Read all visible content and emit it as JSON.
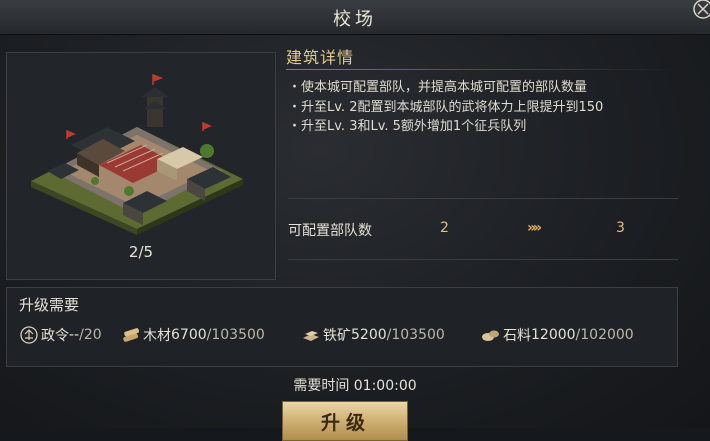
{
  "window": {
    "title": "校场"
  },
  "preview": {
    "level": "2/5"
  },
  "details": {
    "title": "建筑详情",
    "lines": [
      "・使本城可配置部队，并提高本城可配置的部队数量",
      "・升至Lv. 2配置到本城部队的武将体力上限提升到150",
      "・升至Lv. 3和Lv. 5额外增加1个征兵队列"
    ],
    "stat": {
      "label": "可配置部队数",
      "current": "2",
      "arrow": "»»",
      "next": "3"
    }
  },
  "requirements": {
    "title": "升级需要",
    "items": [
      {
        "name": "政令",
        "have": "--",
        "need": "/20",
        "icon": "decree-icon"
      },
      {
        "name": "木材",
        "have": "6700",
        "need": "/103500",
        "icon": "wood-icon"
      },
      {
        "name": "铁矿",
        "have": "5200",
        "need": "/103500",
        "icon": "iron-icon"
      },
      {
        "name": "石料",
        "have": "12000",
        "need": "/102000",
        "icon": "stone-icon"
      }
    ]
  },
  "time": {
    "text": "需要时间 01:00:00"
  },
  "upgrade": {
    "label": "升级"
  },
  "colors": {
    "accent": "#e4c98c",
    "button": "#cfb073",
    "value": "#e0c17a"
  }
}
